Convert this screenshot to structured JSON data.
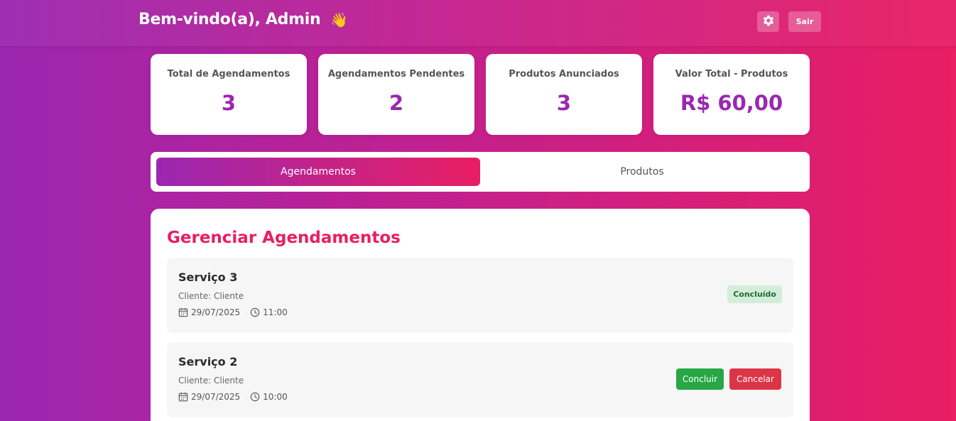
{
  "header": {
    "welcome": "Bem-vindo(a), Admin",
    "wave_emoji": "👋",
    "settings_icon": "gear-icon",
    "logout_label": "Sair"
  },
  "stats": [
    {
      "label": "Total de Agendamentos",
      "value": "3"
    },
    {
      "label": "Agendamentos Pendentes",
      "value": "2"
    },
    {
      "label": "Produtos Anunciados",
      "value": "3"
    },
    {
      "label": "Valor Total - Produtos",
      "value": "R$ 60,00"
    }
  ],
  "tabs": [
    {
      "label": "Agendamentos",
      "active": true
    },
    {
      "label": "Produtos",
      "active": false
    }
  ],
  "panel": {
    "title": "Gerenciar Agendamentos",
    "appointments": [
      {
        "service": "Serviço 3",
        "client": "Cliente: Cliente",
        "date": "29/07/2025",
        "time": "11:00",
        "status": "Concluído"
      },
      {
        "service": "Serviço 2",
        "client": "Cliente: Cliente",
        "date": "29/07/2025",
        "time": "10:00",
        "actions": {
          "conclude": "Concluir",
          "cancel": "Cancelar"
        }
      }
    ]
  },
  "colors": {
    "accent_purple": "#9b27b0",
    "accent_pink": "#e91e63",
    "success": "#28a745",
    "danger": "#dc3545",
    "badge_bg": "#d4edda"
  }
}
